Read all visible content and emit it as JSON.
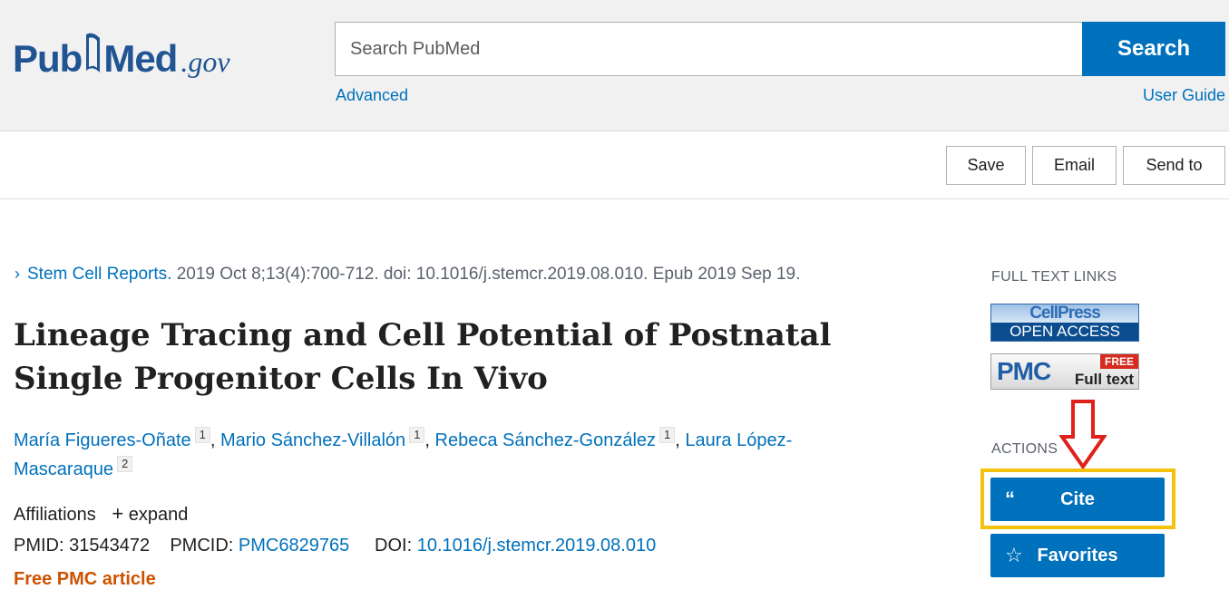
{
  "header": {
    "logo": {
      "pub": "Pub",
      "med": "Med",
      "gov": ".gov"
    },
    "search": {
      "placeholder": "Search PubMed",
      "button_label": "Search"
    },
    "advanced_link": "Advanced",
    "user_guide_link": "User Guide"
  },
  "toolbar": {
    "save_label": "Save",
    "email_label": "Email",
    "send_to_label": "Send to"
  },
  "article": {
    "journal": "Stem Cell Reports.",
    "citation": " 2019 Oct 8;13(4):700-712. doi: 10.1016/j.stemcr.2019.08.010. Epub 2019 Sep 19.",
    "title": "Lineage Tracing and Cell Potential of Postnatal Single Progenitor Cells In Vivo",
    "authors": [
      {
        "name": "María Figueres-Oñate",
        "affil": "1"
      },
      {
        "name": "Mario Sánchez-Villalón",
        "affil": "1"
      },
      {
        "name": "Rebeca Sánchez-González",
        "affil": "1"
      },
      {
        "name": "Laura López-Mascaraque",
        "affil": "2"
      }
    ],
    "affiliations_label": "Affiliations",
    "expand_label": "expand",
    "pmid_label": "PMID:",
    "pmid": "31543472",
    "pmcid_label": "PMCID:",
    "pmcid": "PMC6829765",
    "doi_label": "DOI:",
    "doi": "10.1016/j.stemcr.2019.08.010",
    "free_label": "Free PMC article"
  },
  "sidebar": {
    "full_text_links_heading": "FULL TEXT LINKS",
    "cellpress": {
      "top": "CellPress",
      "bottom": "OPEN ACCESS"
    },
    "pmc": {
      "logo": "PMC",
      "tag": "FREE",
      "text": "Full text"
    },
    "actions_heading": "ACTIONS",
    "cite_label": "Cite",
    "favorites_label": "Favorites"
  },
  "colors": {
    "link": "#0071bc",
    "free_article": "#cd5300",
    "highlight": "#f4c20d",
    "arrow": "#e0201b"
  }
}
